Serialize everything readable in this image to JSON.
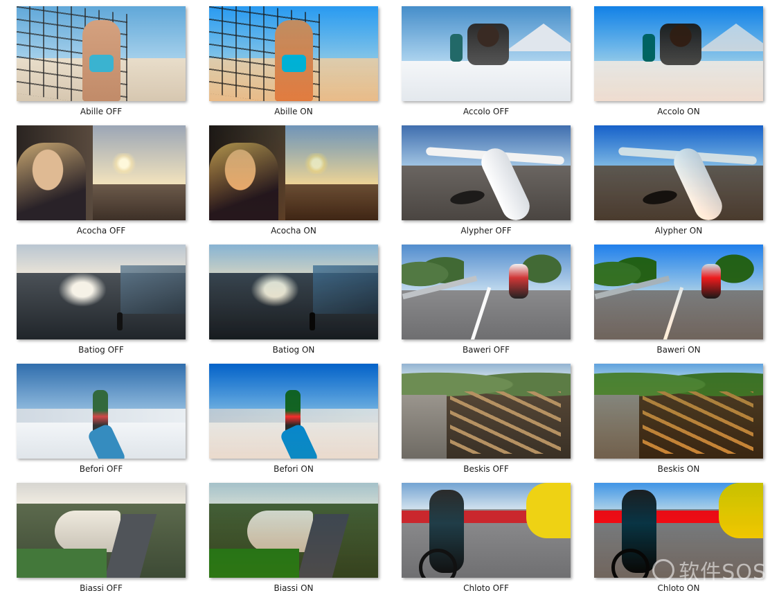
{
  "thumbnails": [
    {
      "caption": "Abille OFF",
      "scene": "beach-volley",
      "tone": "off"
    },
    {
      "caption": "Abille ON",
      "scene": "beach-volley",
      "tone": "on"
    },
    {
      "caption": "Accolo OFF",
      "scene": "snow-group",
      "tone": "off"
    },
    {
      "caption": "Accolo ON",
      "scene": "snow-group",
      "tone": "on"
    },
    {
      "caption": "Acocha OFF",
      "scene": "sunset-hut",
      "tone": "off"
    },
    {
      "caption": "Acocha ON",
      "scene": "sunset-hut",
      "tone": "on"
    },
    {
      "caption": "Alypher OFF",
      "scene": "plane-runway",
      "tone": "off"
    },
    {
      "caption": "Alypher ON",
      "scene": "plane-runway",
      "tone": "on"
    },
    {
      "caption": "Batiog OFF",
      "scene": "shore",
      "tone": "off"
    },
    {
      "caption": "Batiog ON",
      "scene": "shore",
      "tone": "on"
    },
    {
      "caption": "Baweri OFF",
      "scene": "road-cyclist",
      "tone": "off"
    },
    {
      "caption": "Baweri ON",
      "scene": "road-cyclist",
      "tone": "on"
    },
    {
      "caption": "Befori OFF",
      "scene": "snow-skier",
      "tone": "off"
    },
    {
      "caption": "Befori ON",
      "scene": "snow-skier",
      "tone": "on"
    },
    {
      "caption": "Beskis OFF",
      "scene": "wood-frame",
      "tone": "off"
    },
    {
      "caption": "Beskis ON",
      "scene": "wood-frame",
      "tone": "on"
    },
    {
      "caption": "Biassi OFF",
      "scene": "aerial-hotel",
      "tone": "off"
    },
    {
      "caption": "Biassi ON",
      "scene": "aerial-hotel",
      "tone": "on"
    },
    {
      "caption": "Chloto OFF",
      "scene": "race-cyclists",
      "tone": "off"
    },
    {
      "caption": "Chloto ON",
      "scene": "race-cyclists",
      "tone": "on"
    }
  ],
  "watermark": "软件SOS"
}
